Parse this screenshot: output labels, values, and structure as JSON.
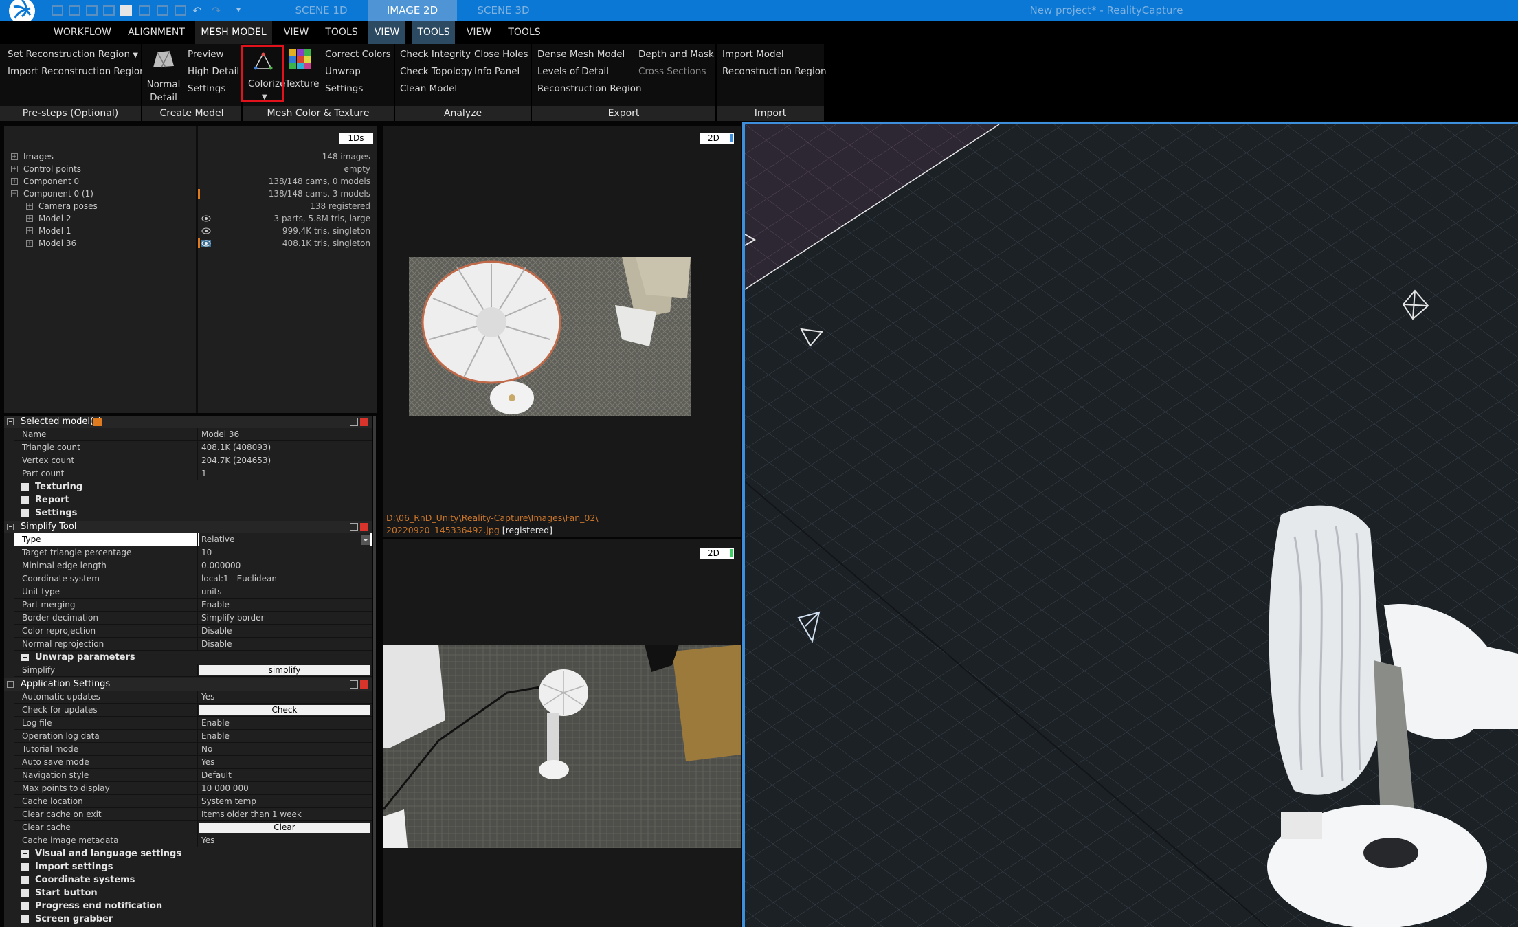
{
  "titlebar": {
    "scene_tabs": [
      "SCENE 1D",
      "IMAGE 2D",
      "SCENE 3D"
    ],
    "app_title": "New project* - RealityCapture"
  },
  "menu": {
    "items": [
      "WORKFLOW",
      "ALIGNMENT",
      "MESH MODEL",
      "VIEW",
      "TOOLS",
      "VIEW",
      "TOOLS",
      "VIEW",
      "TOOLS"
    ]
  },
  "ribbon": {
    "presteps": {
      "label": "Pre-steps (Optional)",
      "set_region": "Set Reconstruction Region",
      "import_region": "Import Reconstruction Region"
    },
    "create_model": {
      "label": "Create Model",
      "normal": "Normal",
      "detail": "Detail",
      "preview": "Preview",
      "high_detail": "High Detail",
      "settings": "Settings"
    },
    "mesh_color": {
      "label": "Mesh Color & Texture",
      "colorize": "Colorize",
      "texture": "Texture",
      "correct_colors": "Correct Colors",
      "unwrap": "Unwrap",
      "settings": "Settings"
    },
    "analyze": {
      "label": "Analyze",
      "check_integrity": "Check Integrity",
      "check_topology": "Check Topology",
      "clean_model": "Clean Model",
      "close_holes": "Close Holes",
      "info_panel": "Info Panel"
    },
    "export": {
      "label": "Export",
      "dense_mesh": "Dense Mesh Model",
      "levels_of_detail": "Levels of Detail",
      "reconstruction_region": "Reconstruction Region",
      "depth_mask": "Depth and Mask",
      "cross_sections": "Cross Sections"
    },
    "import": {
      "label": "Import",
      "import_model": "Import Model",
      "reconstruction_region": "Reconstruction Region"
    }
  },
  "tree": {
    "badge": "1Ds",
    "rows": [
      {
        "name": "Images",
        "value": "148 images"
      },
      {
        "name": "Control points",
        "value": "empty"
      },
      {
        "name": "Component 0",
        "value": "138/148 cams, 0 models"
      },
      {
        "name": "Component 0 (1)",
        "value": "138/148 cams, 3 models"
      },
      {
        "name": "Camera poses",
        "value": "138 registered"
      },
      {
        "name": "Model 2",
        "value": "3 parts, 5.8M tris, large"
      },
      {
        "name": "Model 1",
        "value": "999.4K tris, singleton"
      },
      {
        "name": "Model 36",
        "value": "408.1K tris, singleton"
      }
    ]
  },
  "selected_models": {
    "title": "Selected model(s)",
    "rows": [
      {
        "key": "Name",
        "value": "Model 36"
      },
      {
        "key": "Triangle count",
        "value": "408.1K (408093)"
      },
      {
        "key": "Vertex count",
        "value": "204.7K (204653)"
      },
      {
        "key": "Part count",
        "value": "1"
      }
    ],
    "subsections": [
      "Texturing",
      "Report",
      "Settings"
    ]
  },
  "simplify_tool": {
    "title": "Simplify Tool",
    "rows": [
      {
        "key": "Type",
        "value": "Relative"
      },
      {
        "key": "Target triangle percentage",
        "value": "10"
      },
      {
        "key": "Minimal edge length",
        "value": "0.000000"
      },
      {
        "key": "Coordinate system",
        "value": "local:1 - Euclidean"
      },
      {
        "key": "Unit type",
        "value": "units"
      },
      {
        "key": "Part merging",
        "value": "Enable"
      },
      {
        "key": "Border decimation",
        "value": "Simplify border"
      },
      {
        "key": "Color reprojection",
        "value": "Disable"
      },
      {
        "key": "Normal reprojection",
        "value": "Disable"
      }
    ],
    "unwrap_parameters": "Unwrap parameters",
    "simplify_label": "Simplify",
    "simplify_button": "simplify"
  },
  "app_settings": {
    "title": "Application Settings",
    "rows": [
      {
        "key": "Automatic updates",
        "value": "Yes"
      },
      {
        "key": "Check for updates",
        "value": "Check"
      },
      {
        "key": "Log file",
        "value": "Enable"
      },
      {
        "key": "Operation log data",
        "value": "Enable"
      },
      {
        "key": "Tutorial mode",
        "value": "No"
      },
      {
        "key": "Auto save mode",
        "value": "Yes"
      },
      {
        "key": "Navigation style",
        "value": "Default"
      },
      {
        "key": "Max points to display",
        "value": "10 000 000"
      },
      {
        "key": "Cache location",
        "value": "System temp"
      },
      {
        "key": "Clear cache on exit",
        "value": "Items older than 1 week"
      },
      {
        "key": "Clear cache",
        "value": "Clear"
      },
      {
        "key": "Cache image metadata",
        "value": "Yes"
      }
    ],
    "subsections": [
      "Visual and language settings",
      "Import settings",
      "Coordinate systems",
      "Start button",
      "Progress end notification",
      "Screen grabber"
    ]
  },
  "image_view_top": {
    "badge": "2D",
    "path_line1": "D:\\06_RnD_Unity\\Reality-Capture\\Images\\Fan_02\\",
    "path_line2": "20220920_145336492.jpg",
    "status": "[registered]"
  },
  "image_view_bottom": {
    "badge": "2D"
  },
  "colors": {
    "accent": "#0a78d4",
    "highlight_box": "#e1121c",
    "path_text": "#c8742a"
  }
}
